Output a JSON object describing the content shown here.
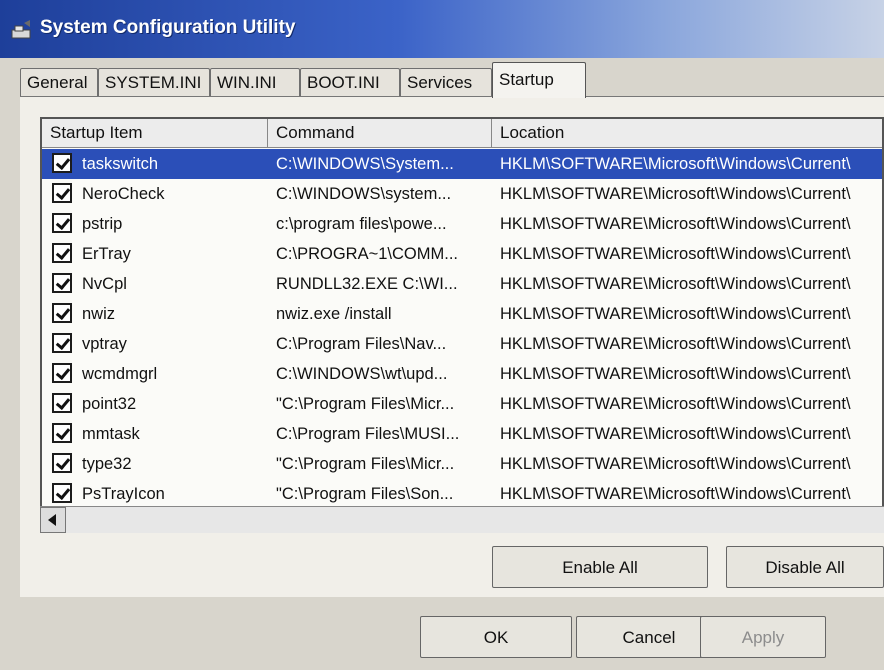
{
  "window": {
    "title": "System Configuration Utility"
  },
  "tabs": [
    {
      "label": "General"
    },
    {
      "label": "SYSTEM.INI"
    },
    {
      "label": "WIN.INI"
    },
    {
      "label": "BOOT.INI"
    },
    {
      "label": "Services"
    },
    {
      "label": "Startup"
    }
  ],
  "table": {
    "columns": [
      "Startup Item",
      "Command",
      "Location"
    ],
    "rows": [
      {
        "item": "taskswitch",
        "command": "C:\\WINDOWS\\System...",
        "location": "HKLM\\SOFTWARE\\Microsoft\\Windows\\Current\\"
      },
      {
        "item": "NeroCheck",
        "command": "C:\\WINDOWS\\system...",
        "location": "HKLM\\SOFTWARE\\Microsoft\\Windows\\Current\\"
      },
      {
        "item": "pstrip",
        "command": "c:\\program files\\powe...",
        "location": "HKLM\\SOFTWARE\\Microsoft\\Windows\\Current\\"
      },
      {
        "item": "ErTray",
        "command": "C:\\PROGRA~1\\COMM...",
        "location": "HKLM\\SOFTWARE\\Microsoft\\Windows\\Current\\"
      },
      {
        "item": "NvCpl",
        "command": "RUNDLL32.EXE C:\\WI...",
        "location": "HKLM\\SOFTWARE\\Microsoft\\Windows\\Current\\"
      },
      {
        "item": "nwiz",
        "command": "nwiz.exe /install",
        "location": "HKLM\\SOFTWARE\\Microsoft\\Windows\\Current\\"
      },
      {
        "item": "vptray",
        "command": "C:\\Program Files\\Nav...",
        "location": "HKLM\\SOFTWARE\\Microsoft\\Windows\\Current\\"
      },
      {
        "item": "wcmdmgrl",
        "command": "C:\\WINDOWS\\wt\\upd...",
        "location": "HKLM\\SOFTWARE\\Microsoft\\Windows\\Current\\"
      },
      {
        "item": "point32",
        "command": "\"C:\\Program Files\\Micr...",
        "location": "HKLM\\SOFTWARE\\Microsoft\\Windows\\Current\\"
      },
      {
        "item": "mmtask",
        "command": "C:\\Program Files\\MUSI...",
        "location": "HKLM\\SOFTWARE\\Microsoft\\Windows\\Current\\"
      },
      {
        "item": "type32",
        "command": "\"C:\\Program Files\\Micr...",
        "location": "HKLM\\SOFTWARE\\Microsoft\\Windows\\Current\\"
      },
      {
        "item": "PsTrayIcon",
        "command": "\"C:\\Program Files\\Son...",
        "location": "HKLM\\SOFTWARE\\Microsoft\\Windows\\Current\\"
      }
    ]
  },
  "buttons": {
    "enable_all": "Enable All",
    "disable_all": "Disable All",
    "ok": "OK",
    "cancel": "Cancel",
    "apply": "Apply"
  }
}
